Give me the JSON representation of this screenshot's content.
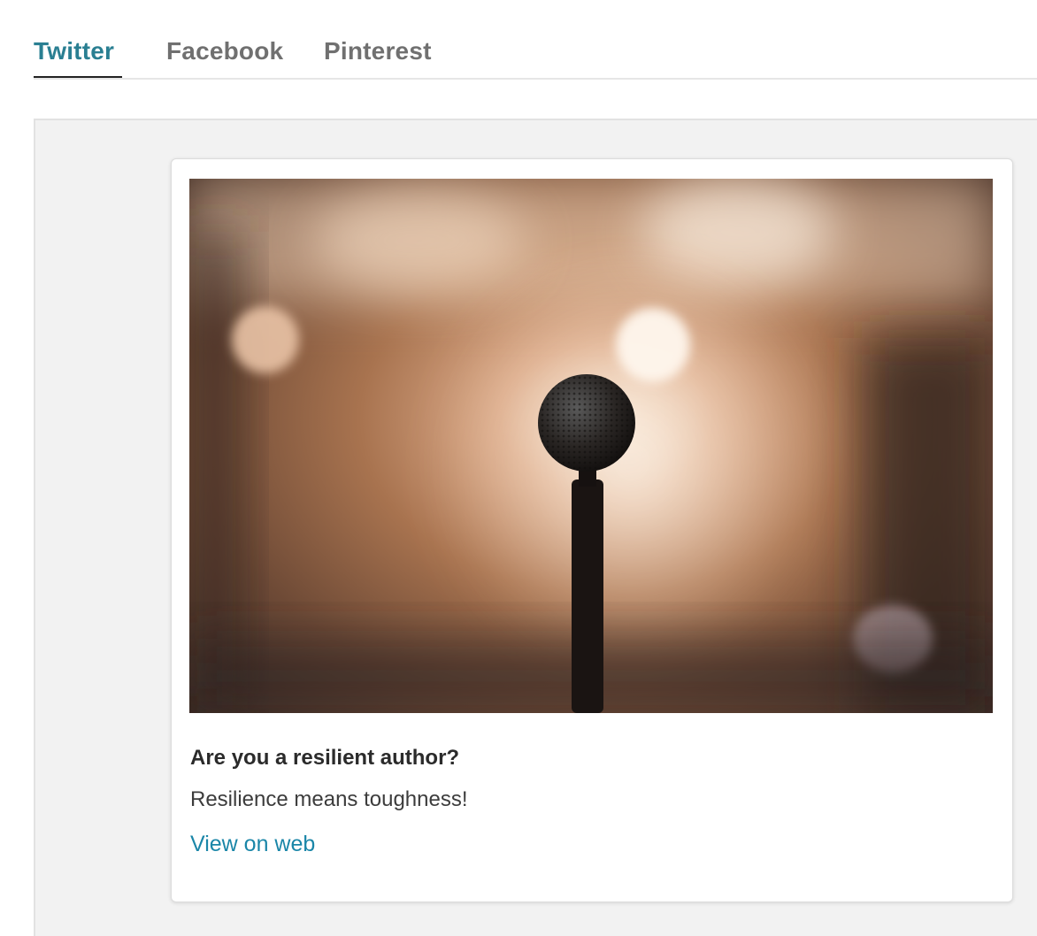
{
  "tabs": [
    {
      "label": "Twitter",
      "active": true
    },
    {
      "label": "Facebook",
      "active": false
    },
    {
      "label": "Pinterest",
      "active": false
    }
  ],
  "card": {
    "image_alt": "Microphone on a stand in front of a blurred warm-toned stage background",
    "title": "Are you a resilient author?",
    "description": "Resilience means toughness!",
    "link_label": "View on web"
  },
  "colors": {
    "active_tab": "#2a7f92",
    "inactive_tab": "#707070",
    "link": "#1a86a8",
    "preview_background": "#f2f2f2"
  }
}
